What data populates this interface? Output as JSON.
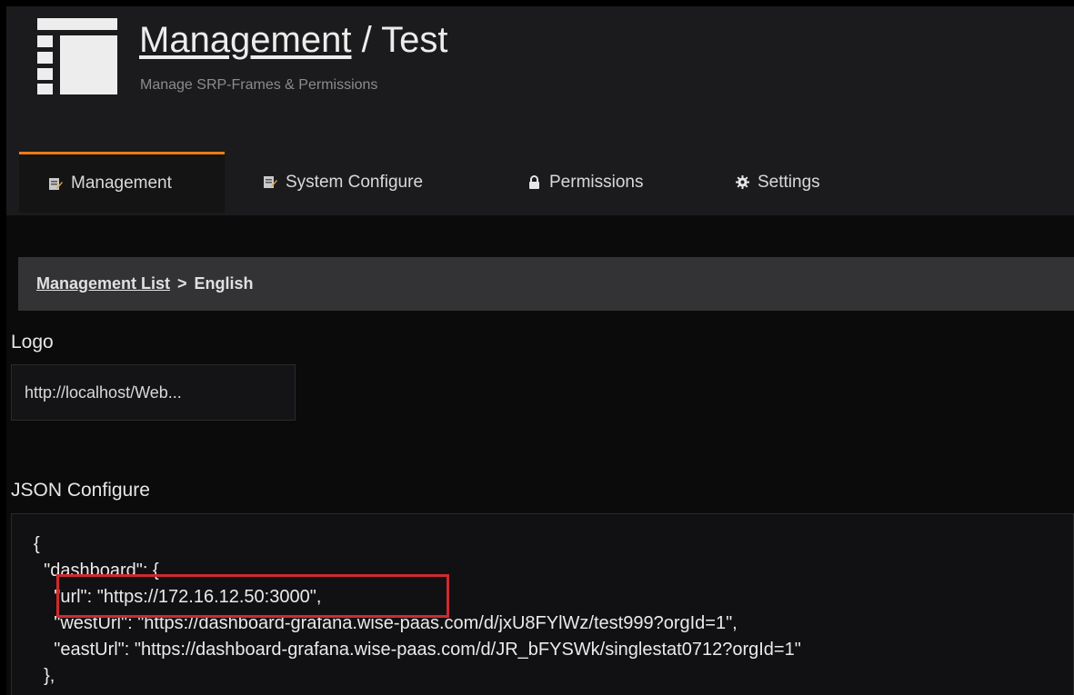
{
  "header": {
    "title_link": "Management",
    "title_separator": " / ",
    "title_page": "Test",
    "subtitle": "Manage SRP-Frames & Permissions"
  },
  "tabs": [
    {
      "label": "Management",
      "icon": "edit-doc-icon",
      "active": true
    },
    {
      "label": "System Configure",
      "icon": "edit-doc-icon",
      "active": false
    },
    {
      "label": "Permissions",
      "icon": "lock-icon",
      "active": false
    },
    {
      "label": "Settings",
      "icon": "gear-icon",
      "active": false
    }
  ],
  "breadcrumb": {
    "link": "Management List",
    "separator": ">",
    "current": "English"
  },
  "logo_section": {
    "label": "Logo",
    "value": "http://localhost/Web..."
  },
  "json_section": {
    "label": "JSON Configure",
    "lines": [
      "{",
      "  \"dashboard\": {",
      "    \"url\": \"https://172.16.12.50:3000\",",
      "    \"westUrl\": \"https://dashboard-grafana.wise-paas.com/d/jxU8FYlWz/test999?orgId=1\",",
      "    \"eastUrl\": \"https://dashboard-grafana.wise-paas.com/d/JR_bFYSWk/singlestat0712?orgId=1\"",
      "  },"
    ]
  },
  "colors": {
    "accent_tab": "#eb7b18",
    "highlight": "#d0292f",
    "header_bg": "#1b1b1d",
    "breadcrumb_bg": "#333335"
  }
}
